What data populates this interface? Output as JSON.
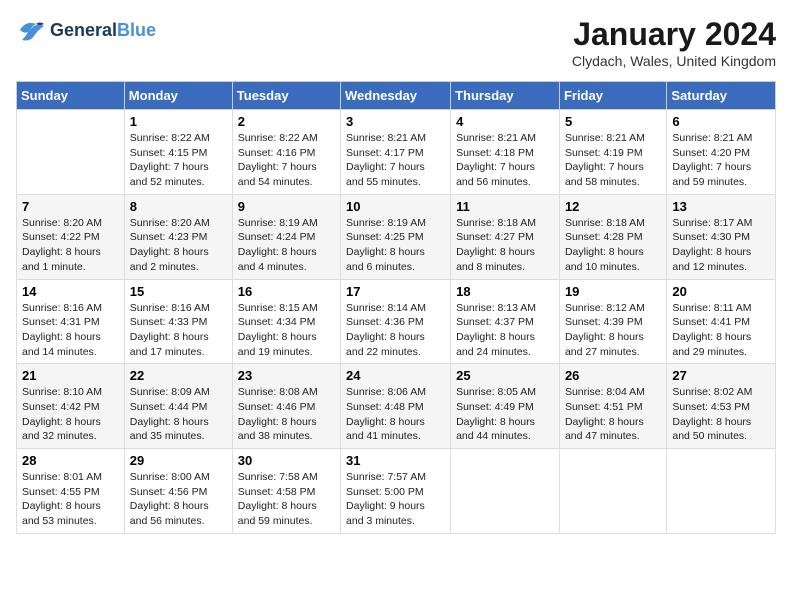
{
  "logo": {
    "line1": "General",
    "line2": "Blue"
  },
  "title": "January 2024",
  "location": "Clydach, Wales, United Kingdom",
  "days_of_week": [
    "Sunday",
    "Monday",
    "Tuesday",
    "Wednesday",
    "Thursday",
    "Friday",
    "Saturday"
  ],
  "weeks": [
    [
      {
        "day": "",
        "info": ""
      },
      {
        "day": "1",
        "info": "Sunrise: 8:22 AM\nSunset: 4:15 PM\nDaylight: 7 hours\nand 52 minutes."
      },
      {
        "day": "2",
        "info": "Sunrise: 8:22 AM\nSunset: 4:16 PM\nDaylight: 7 hours\nand 54 minutes."
      },
      {
        "day": "3",
        "info": "Sunrise: 8:21 AM\nSunset: 4:17 PM\nDaylight: 7 hours\nand 55 minutes."
      },
      {
        "day": "4",
        "info": "Sunrise: 8:21 AM\nSunset: 4:18 PM\nDaylight: 7 hours\nand 56 minutes."
      },
      {
        "day": "5",
        "info": "Sunrise: 8:21 AM\nSunset: 4:19 PM\nDaylight: 7 hours\nand 58 minutes."
      },
      {
        "day": "6",
        "info": "Sunrise: 8:21 AM\nSunset: 4:20 PM\nDaylight: 7 hours\nand 59 minutes."
      }
    ],
    [
      {
        "day": "7",
        "info": "Sunrise: 8:20 AM\nSunset: 4:22 PM\nDaylight: 8 hours\nand 1 minute."
      },
      {
        "day": "8",
        "info": "Sunrise: 8:20 AM\nSunset: 4:23 PM\nDaylight: 8 hours\nand 2 minutes."
      },
      {
        "day": "9",
        "info": "Sunrise: 8:19 AM\nSunset: 4:24 PM\nDaylight: 8 hours\nand 4 minutes."
      },
      {
        "day": "10",
        "info": "Sunrise: 8:19 AM\nSunset: 4:25 PM\nDaylight: 8 hours\nand 6 minutes."
      },
      {
        "day": "11",
        "info": "Sunrise: 8:18 AM\nSunset: 4:27 PM\nDaylight: 8 hours\nand 8 minutes."
      },
      {
        "day": "12",
        "info": "Sunrise: 8:18 AM\nSunset: 4:28 PM\nDaylight: 8 hours\nand 10 minutes."
      },
      {
        "day": "13",
        "info": "Sunrise: 8:17 AM\nSunset: 4:30 PM\nDaylight: 8 hours\nand 12 minutes."
      }
    ],
    [
      {
        "day": "14",
        "info": "Sunrise: 8:16 AM\nSunset: 4:31 PM\nDaylight: 8 hours\nand 14 minutes."
      },
      {
        "day": "15",
        "info": "Sunrise: 8:16 AM\nSunset: 4:33 PM\nDaylight: 8 hours\nand 17 minutes."
      },
      {
        "day": "16",
        "info": "Sunrise: 8:15 AM\nSunset: 4:34 PM\nDaylight: 8 hours\nand 19 minutes."
      },
      {
        "day": "17",
        "info": "Sunrise: 8:14 AM\nSunset: 4:36 PM\nDaylight: 8 hours\nand 22 minutes."
      },
      {
        "day": "18",
        "info": "Sunrise: 8:13 AM\nSunset: 4:37 PM\nDaylight: 8 hours\nand 24 minutes."
      },
      {
        "day": "19",
        "info": "Sunrise: 8:12 AM\nSunset: 4:39 PM\nDaylight: 8 hours\nand 27 minutes."
      },
      {
        "day": "20",
        "info": "Sunrise: 8:11 AM\nSunset: 4:41 PM\nDaylight: 8 hours\nand 29 minutes."
      }
    ],
    [
      {
        "day": "21",
        "info": "Sunrise: 8:10 AM\nSunset: 4:42 PM\nDaylight: 8 hours\nand 32 minutes."
      },
      {
        "day": "22",
        "info": "Sunrise: 8:09 AM\nSunset: 4:44 PM\nDaylight: 8 hours\nand 35 minutes."
      },
      {
        "day": "23",
        "info": "Sunrise: 8:08 AM\nSunset: 4:46 PM\nDaylight: 8 hours\nand 38 minutes."
      },
      {
        "day": "24",
        "info": "Sunrise: 8:06 AM\nSunset: 4:48 PM\nDaylight: 8 hours\nand 41 minutes."
      },
      {
        "day": "25",
        "info": "Sunrise: 8:05 AM\nSunset: 4:49 PM\nDaylight: 8 hours\nand 44 minutes."
      },
      {
        "day": "26",
        "info": "Sunrise: 8:04 AM\nSunset: 4:51 PM\nDaylight: 8 hours\nand 47 minutes."
      },
      {
        "day": "27",
        "info": "Sunrise: 8:02 AM\nSunset: 4:53 PM\nDaylight: 8 hours\nand 50 minutes."
      }
    ],
    [
      {
        "day": "28",
        "info": "Sunrise: 8:01 AM\nSunset: 4:55 PM\nDaylight: 8 hours\nand 53 minutes."
      },
      {
        "day": "29",
        "info": "Sunrise: 8:00 AM\nSunset: 4:56 PM\nDaylight: 8 hours\nand 56 minutes."
      },
      {
        "day": "30",
        "info": "Sunrise: 7:58 AM\nSunset: 4:58 PM\nDaylight: 8 hours\nand 59 minutes."
      },
      {
        "day": "31",
        "info": "Sunrise: 7:57 AM\nSunset: 5:00 PM\nDaylight: 9 hours\nand 3 minutes."
      },
      {
        "day": "",
        "info": ""
      },
      {
        "day": "",
        "info": ""
      },
      {
        "day": "",
        "info": ""
      }
    ]
  ]
}
